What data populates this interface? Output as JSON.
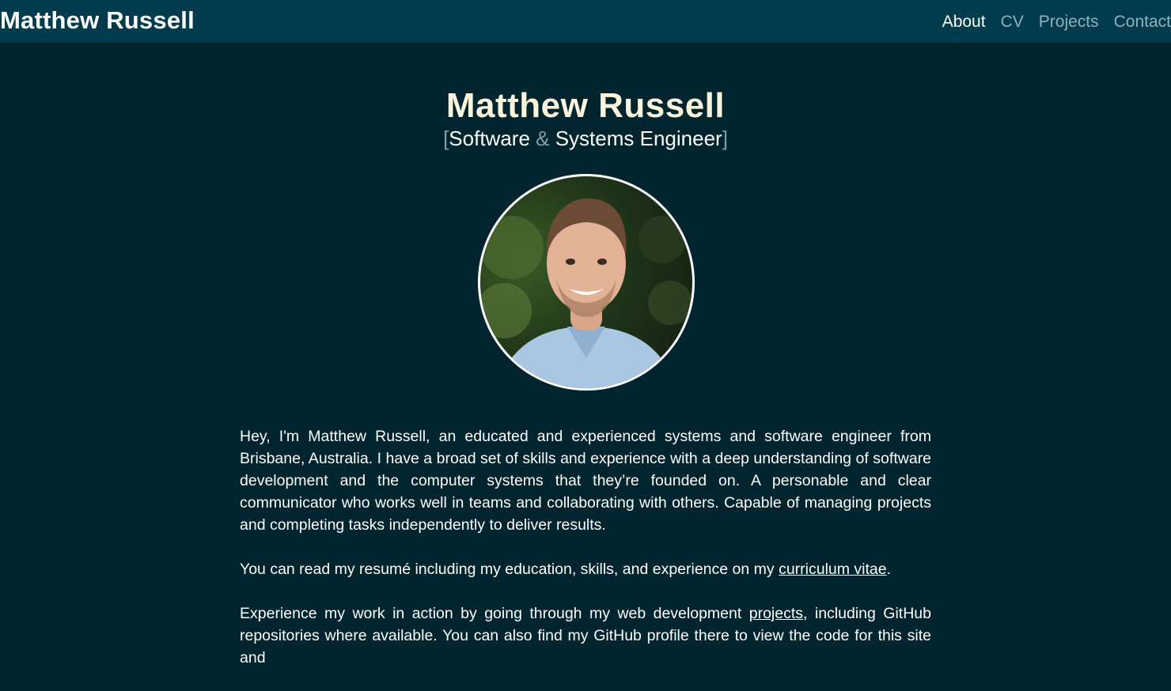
{
  "nav": {
    "brand": "Matthew Russell",
    "links": [
      "About",
      "CV",
      "Projects",
      "Contact"
    ]
  },
  "hero": {
    "name": "Matthew Russell",
    "subtitle_part1": "Software",
    "subtitle_amp": "&",
    "subtitle_part2": "Systems Engineer",
    "bracket_open": "[",
    "bracket_close": "]"
  },
  "content": {
    "p1": "Hey, I'm Matthew Russell, an educated and experienced systems and software engineer from Brisbane, Australia. I have a broad set of skills and experience with a deep understanding of software development and the computer systems that they’re founded on. A personable and clear communicator who works well in teams and collaborating with others. Capable of managing projects and completing tasks independently to deliver results.",
    "p2_before": "You can read my resumé including my education, skills, and experience on my ",
    "p2_link": "curriculum vitae",
    "p2_after": ".",
    "p3_before": "Experience my work in action by going through my web development ",
    "p3_link": "projects",
    "p3_after": ", including GitHub repositories where available. You can also find my GitHub profile there to view the code for this site and"
  },
  "colors": {
    "background": "#00252f",
    "navbar": "#003c4d",
    "title": "#fbf3dc",
    "nav_inactive": "#8fb1b9",
    "accent_muted": "#7f9ea6"
  }
}
